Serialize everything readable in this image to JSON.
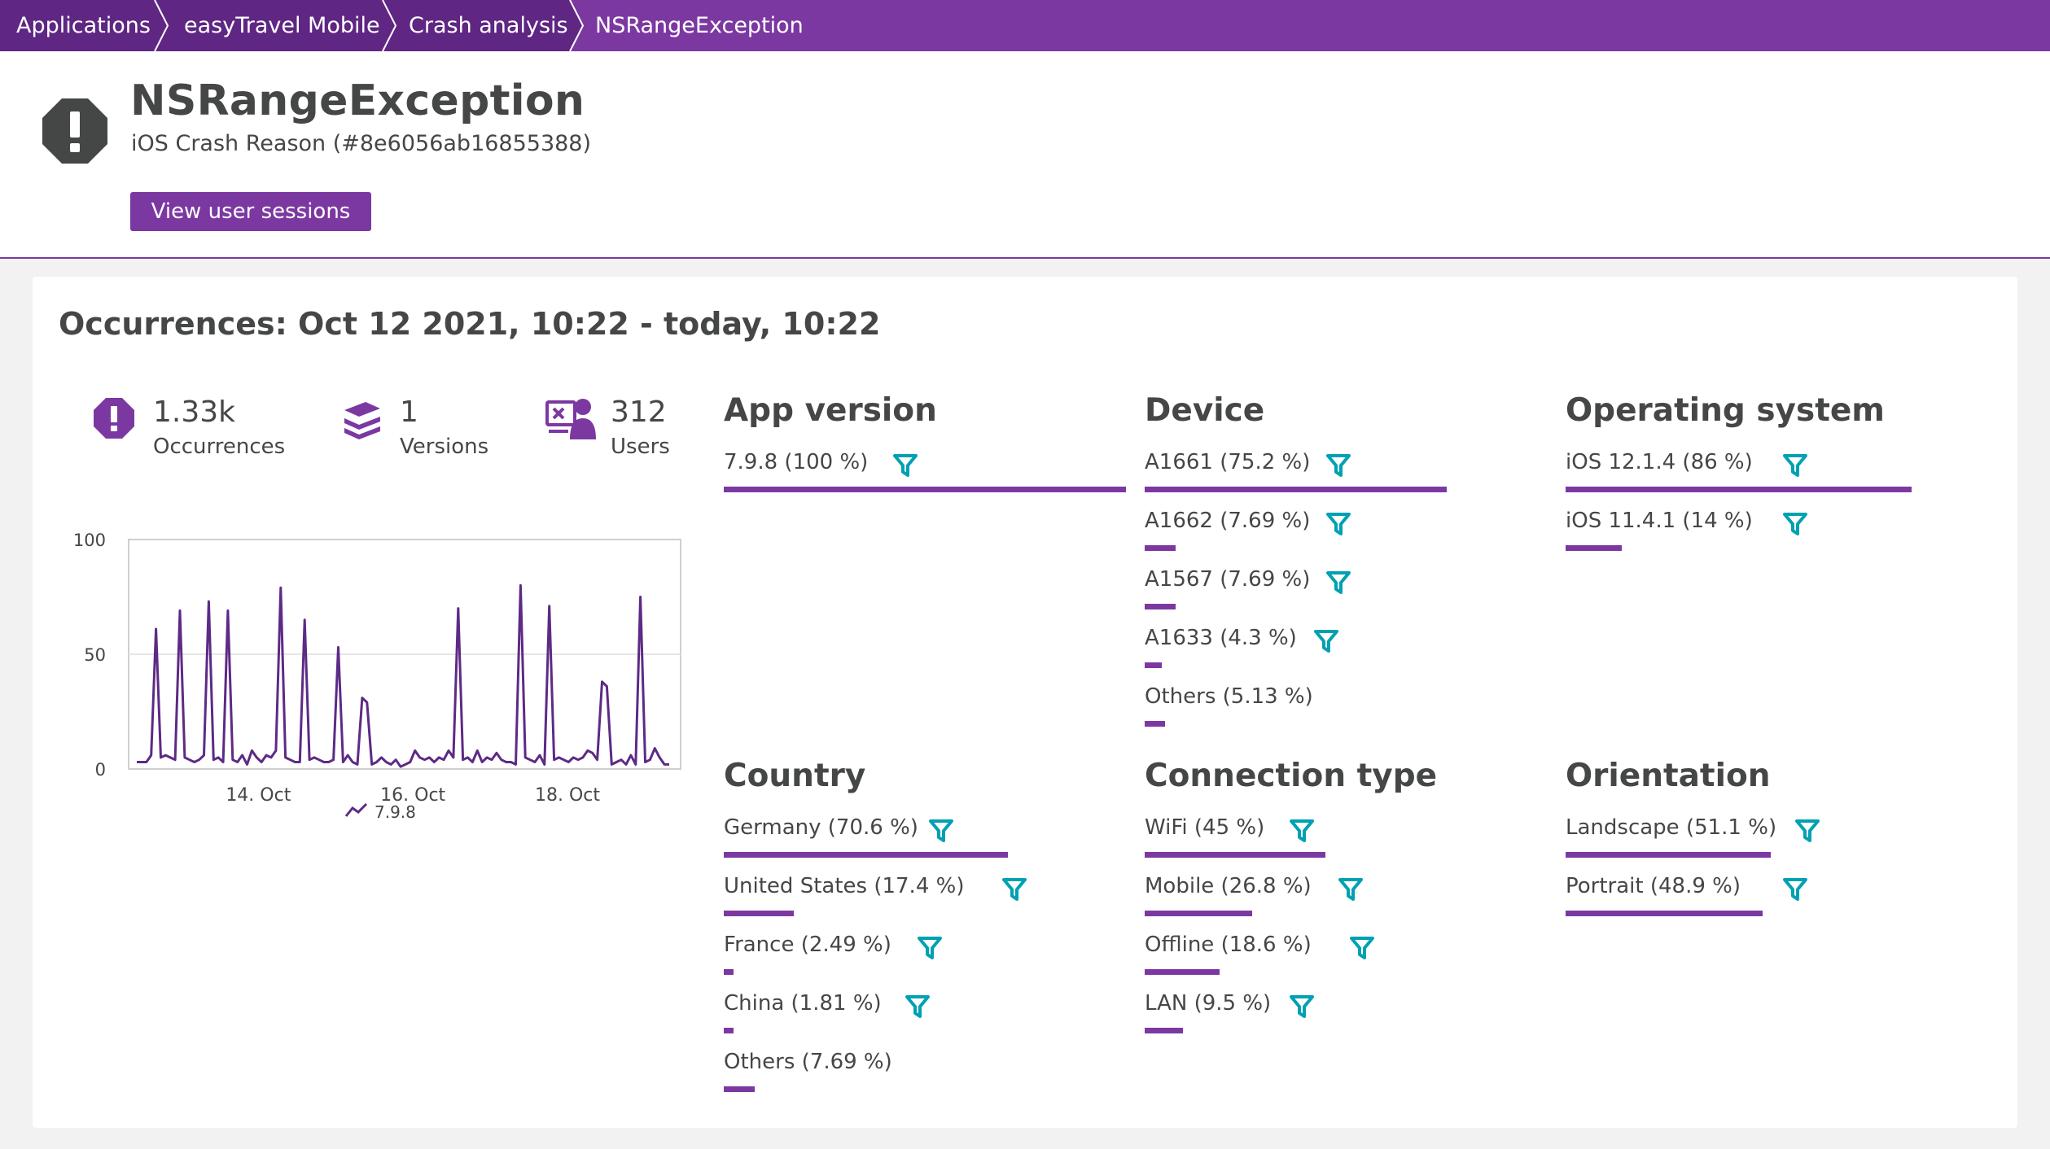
{
  "breadcrumbs": [
    "Applications",
    "easyTravel Mobile",
    "Crash analysis",
    "NSRangeException"
  ],
  "header": {
    "title": "NSRangeException",
    "subtitle": "iOS Crash Reason (#8e6056ab16855388)",
    "button_label": "View user sessions",
    "icon": "exclamation-octagon-icon"
  },
  "occurrences": {
    "title": "Occurrences: Oct 12 2021, 10:22 - today, 10:22",
    "stats": [
      {
        "value": "1.33k",
        "label": "Occurrences",
        "icon": "crash-icon"
      },
      {
        "value": "1",
        "label": "Versions",
        "icon": "versions-stack-icon"
      },
      {
        "value": "312",
        "label": "Users",
        "icon": "users-icon"
      }
    ]
  },
  "chart_data": {
    "type": "line",
    "title": "",
    "xlabel": "",
    "ylabel": "",
    "ylim": [
      0,
      100
    ],
    "yticks": [
      "0",
      "50",
      "100"
    ],
    "xticks": [
      "14. Oct",
      "16. Oct",
      "18. Oct"
    ],
    "series": [
      {
        "name": "7.9.8",
        "color": "#5d2a86",
        "values": [
          3,
          3,
          3,
          6,
          61,
          5,
          6,
          5,
          4,
          69,
          5,
          4,
          3,
          4,
          6,
          73,
          4,
          5,
          3,
          69,
          4,
          3,
          6,
          2,
          8,
          5,
          3,
          6,
          5,
          8,
          79,
          5,
          4,
          3,
          3,
          65,
          4,
          5,
          4,
          3,
          3,
          4,
          53,
          3,
          6,
          3,
          2,
          31,
          29,
          2,
          3,
          5,
          3,
          2,
          4,
          1,
          2,
          3,
          8,
          5,
          4,
          5,
          3,
          5,
          4,
          8,
          5,
          70,
          4,
          5,
          3,
          8,
          3,
          5,
          4,
          7,
          4,
          3,
          3,
          2,
          80,
          5,
          4,
          3,
          6,
          2,
          71,
          4,
          5,
          4,
          3,
          5,
          4,
          5,
          8,
          7,
          4,
          38,
          36,
          2,
          3,
          4,
          2,
          6,
          2,
          75,
          3,
          4,
          9,
          5,
          2,
          2
        ]
      }
    ]
  },
  "breakdowns": [
    {
      "title": "App version",
      "rows": [
        {
          "label": "7.9.8 (100 %)",
          "pct": 100,
          "filter": true
        }
      ]
    },
    {
      "title": "Device",
      "rows": [
        {
          "label": "A1661 (75.2 %)",
          "pct": 75.2,
          "filter": true
        },
        {
          "label": "A1662 (7.69 %)",
          "pct": 7.69,
          "filter": true
        },
        {
          "label": "A1567 (7.69 %)",
          "pct": 7.69,
          "filter": true
        },
        {
          "label": "A1633 (4.3 %)",
          "pct": 4.3,
          "filter": true
        },
        {
          "label": "Others (5.13 %)",
          "pct": 5.13,
          "filter": false
        }
      ]
    },
    {
      "title": "Operating system",
      "rows": [
        {
          "label": "iOS 12.1.4 (86 %)",
          "pct": 86,
          "filter": true
        },
        {
          "label": "iOS 11.4.1 (14 %)",
          "pct": 14,
          "filter": true
        }
      ]
    },
    {
      "title": "Country",
      "rows": [
        {
          "label": "Germany (70.6 %)",
          "pct": 70.6,
          "filter": true
        },
        {
          "label": "United States (17.4 %)",
          "pct": 17.4,
          "filter": true
        },
        {
          "label": "France (2.49 %)",
          "pct": 2.49,
          "filter": true
        },
        {
          "label": "China (1.81 %)",
          "pct": 1.81,
          "filter": true
        },
        {
          "label": "Others (7.69 %)",
          "pct": 7.69,
          "filter": false
        }
      ]
    },
    {
      "title": "Connection type",
      "rows": [
        {
          "label": "WiFi (45 %)",
          "pct": 45,
          "filter": true
        },
        {
          "label": "Mobile (26.8 %)",
          "pct": 26.8,
          "filter": true
        },
        {
          "label": "Offline (18.6 %)",
          "pct": 18.6,
          "filter": true
        },
        {
          "label": "LAN (9.5 %)",
          "pct": 9.5,
          "filter": true
        }
      ]
    },
    {
      "title": "Orientation",
      "rows": [
        {
          "label": "Landscape (51.1 %)",
          "pct": 51.1,
          "filter": true
        },
        {
          "label": "Portrait (48.9 %)",
          "pct": 48.9,
          "filter": true
        }
      ]
    }
  ],
  "colors": {
    "brand": "#7c38a1",
    "crumb_dark": "#5f2683",
    "filter": "#00a1b2",
    "line": "#5d2a86"
  }
}
